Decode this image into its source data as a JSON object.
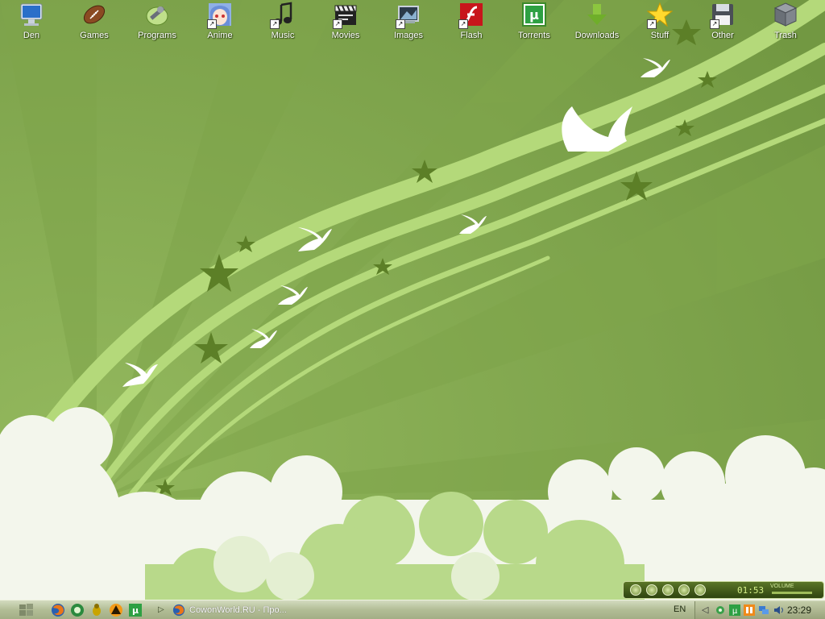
{
  "desktop": {
    "icons": [
      {
        "label": "Den",
        "icon": "computer-icon"
      },
      {
        "label": "Games",
        "icon": "football-icon"
      },
      {
        "label": "Programs",
        "icon": "programs-icon"
      },
      {
        "label": "Anime",
        "icon": "anime-icon"
      },
      {
        "label": "Music",
        "icon": "music-note-icon"
      },
      {
        "label": "Movies",
        "icon": "clapperboard-icon"
      },
      {
        "label": "Images",
        "icon": "images-icon"
      },
      {
        "label": "Flash",
        "icon": "flash-icon"
      },
      {
        "label": "Torrents",
        "icon": "utorrent-icon"
      },
      {
        "label": "Downloads",
        "icon": "download-arrow-icon"
      },
      {
        "label": "Stuff",
        "icon": "star-icon"
      },
      {
        "label": "Other",
        "icon": "floppy-disk-icon"
      },
      {
        "label": "Trash",
        "icon": "trash-icon"
      }
    ]
  },
  "taskbar": {
    "quick_launch": [
      "firefox-icon",
      "green-circle-icon",
      "bug-icon",
      "aimp-icon",
      "utorrent-icon"
    ],
    "task_item": "CowonWorld.RU - Про...",
    "language": "EN",
    "clock": "23:29"
  },
  "player": {
    "time": "01:53",
    "volume_label": "VOLUME"
  },
  "colors": {
    "background": "#7da34a",
    "stripe": "#a9cf6c",
    "taskbar": "#c0c9a3"
  }
}
